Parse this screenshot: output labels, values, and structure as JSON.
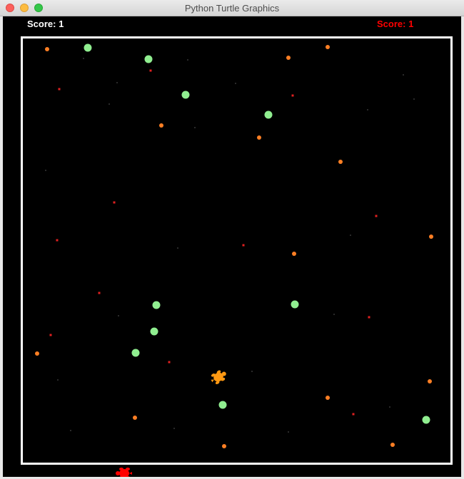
{
  "window": {
    "title": "Python Turtle Graphics"
  },
  "hud": {
    "player1_score": "Score: 1",
    "player2_score": "Score: 1"
  },
  "colors": {
    "background": "#000000",
    "border": "#ffffff",
    "green_food": "#90ee90",
    "orange_food": "#ff7f24",
    "red_mine": "#e02020",
    "star": "#aaaaaa",
    "player1": "#ff9912",
    "player2": "#ff0000"
  },
  "icons": {
    "player1": "turtle-icon",
    "player2": "turtle-icon"
  },
  "game_objects": {
    "green_food_count": 12,
    "orange_food_count": 20,
    "red_mine_count": 13
  }
}
